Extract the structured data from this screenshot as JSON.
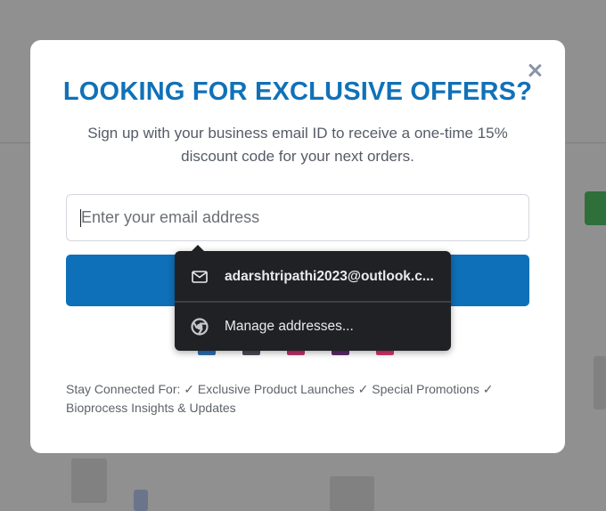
{
  "modal": {
    "title": "LOOKING FOR EXCLUSIVE OFFERS?",
    "subtitle": "Sign up with your business email ID to receive a one-time 15% discount code for your next orders.",
    "email_placeholder": "Enter your email address",
    "footer": "Stay Connected For: ✓ Exclusive Product Launches ✓ Special Promotions ✓ Bioprocess Insights & Updates",
    "close_icon": "close-icon"
  },
  "autofill": {
    "suggestion_email": "adarshtripathi2023@outlook.c...",
    "suggestion_icon": "mail-icon",
    "manage_label": "Manage addresses...",
    "manage_icon": "chrome-icon"
  },
  "colors": {
    "accent": "#1071b8",
    "button": "#0e70b8",
    "popup_bg": "#202124",
    "overlay": "#909090"
  }
}
